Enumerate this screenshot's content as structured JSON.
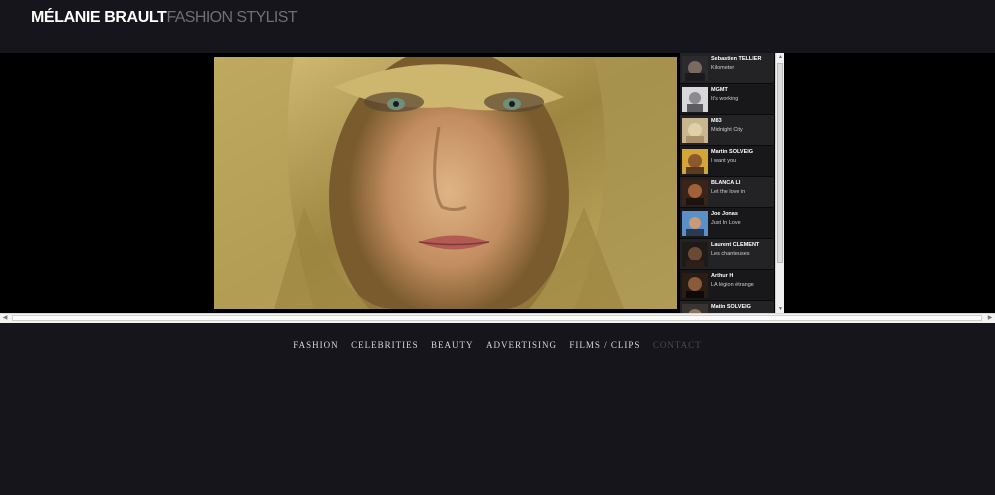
{
  "brand": {
    "name": "MÉLANIE BRAULT",
    "subtitle": "FASHION STYLIST"
  },
  "playlist": [
    {
      "artist": "Sebastien TELLIER",
      "song": "Kilometer"
    },
    {
      "artist": "MGMT",
      "song": "It's working"
    },
    {
      "artist": "M83",
      "song": "Midnight City"
    },
    {
      "artist": "Martin SOLVEIG",
      "song": "I want you"
    },
    {
      "artist": "BLANCA LI",
      "song": "Let the love in"
    },
    {
      "artist": "Joe Jonas",
      "song": "Just In Love"
    },
    {
      "artist": "Laurent CLEMENT",
      "song": "Les chanteuses"
    },
    {
      "artist": "Arthur H",
      "song": "LA légion étrange"
    },
    {
      "artist": "Matin SOLVEIG",
      "song": ""
    }
  ],
  "nav": [
    {
      "label": "FASHION"
    },
    {
      "label": "CELEBRITIES"
    },
    {
      "label": "BEAUTY"
    },
    {
      "label": "ADVERTISING"
    },
    {
      "label": "FILMS / CLIPS"
    },
    {
      "label": "CONTACT"
    }
  ]
}
